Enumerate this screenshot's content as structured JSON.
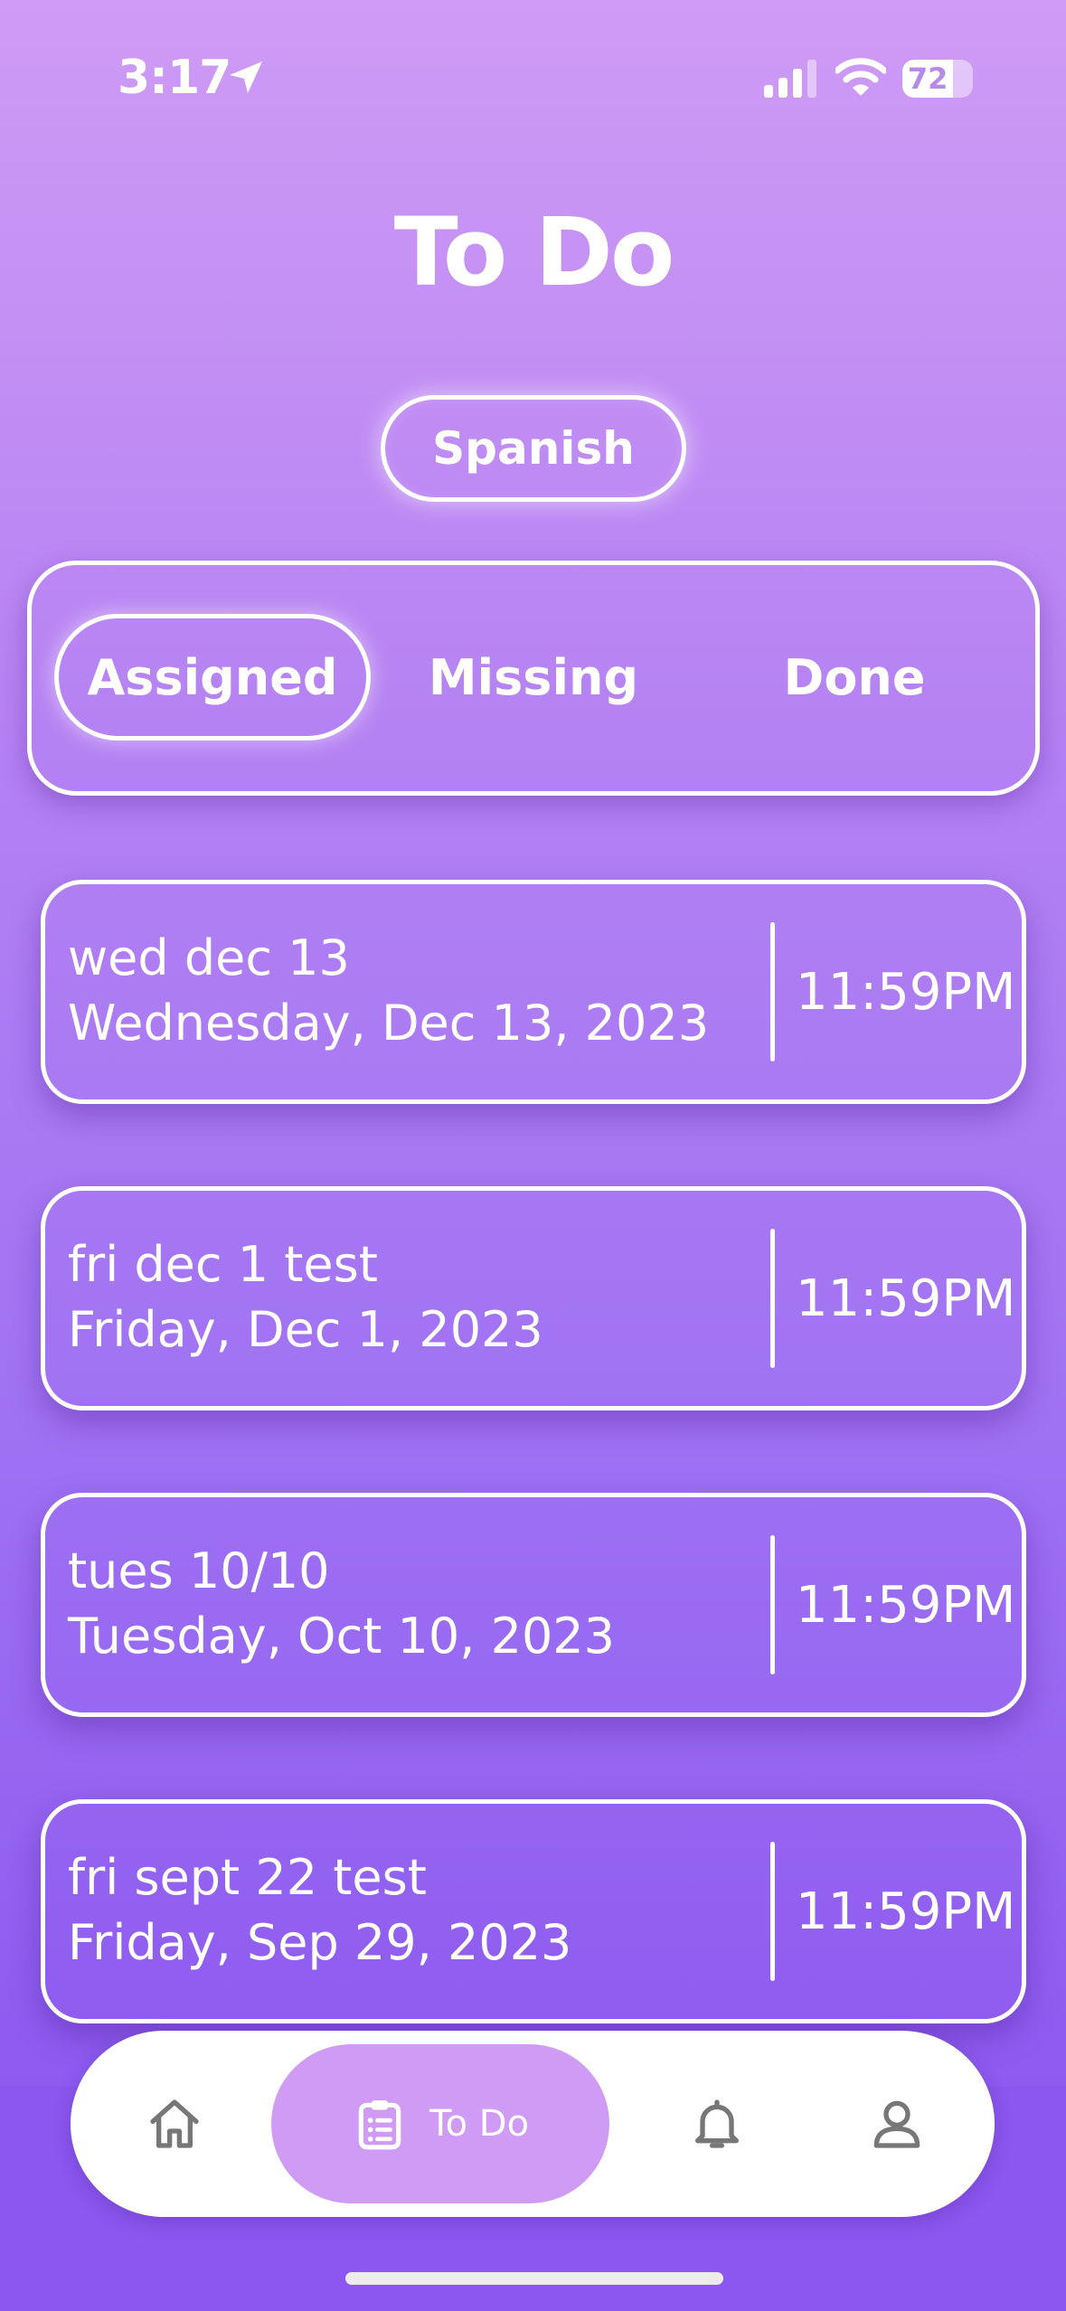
{
  "status_bar": {
    "time": "3:17",
    "battery_level": "72",
    "battery_fraction": 0.72,
    "icons": [
      "location-arrow-icon",
      "cellular-signal-icon",
      "wifi-icon",
      "battery-icon"
    ]
  },
  "header": {
    "title": "To Do"
  },
  "subject": {
    "label": "Spanish"
  },
  "filter_tabs": [
    {
      "label": "Assigned",
      "selected": true
    },
    {
      "label": "Missing",
      "selected": false
    },
    {
      "label": "Done",
      "selected": false
    }
  ],
  "assignments": [
    {
      "name": "wed dec 13",
      "date": "Wednesday, Dec 13, 2023",
      "time": "11:59PM"
    },
    {
      "name": "fri dec 1 test",
      "date": "Friday, Dec 1, 2023",
      "time": "11:59PM"
    },
    {
      "name": "tues 10/10",
      "date": "Tuesday, Oct 10, 2023",
      "time": "11:59PM"
    },
    {
      "name": "fri sept 22 test",
      "date": "Friday, Sep 29, 2023",
      "time": "11:59PM"
    }
  ],
  "nav": {
    "todo_label": "To Do",
    "icons": [
      "home-icon",
      "clipboard-list-icon",
      "bell-icon",
      "profile-icon"
    ]
  },
  "colors": {
    "gradient_top": "#cf9bf5",
    "gradient_bottom": "#8b57f0",
    "active_nav": "#cf9bf5",
    "icon_gray": "#777777"
  }
}
